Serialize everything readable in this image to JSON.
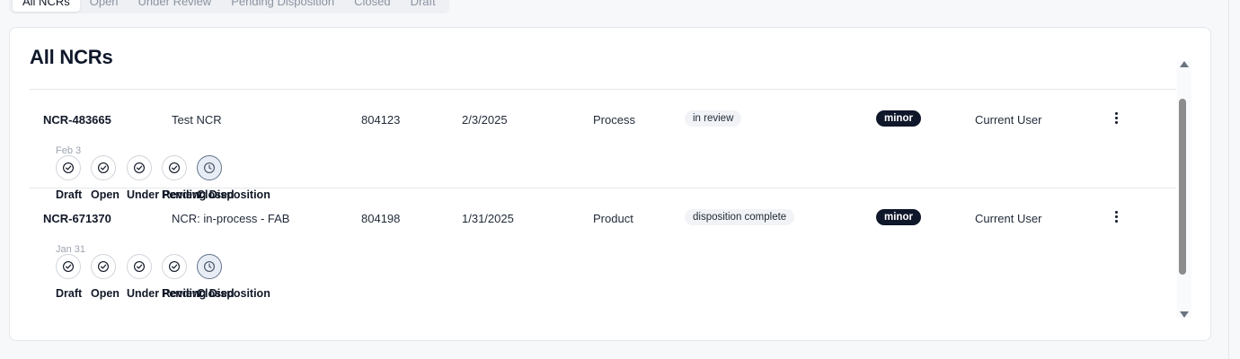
{
  "tabs": [
    "All NCRs",
    "Open",
    "Under Review",
    "Pending Disposition",
    "Closed",
    "Draft"
  ],
  "card_title": "All NCRs",
  "rows": [
    {
      "id": "NCR-483665",
      "title": "Test NCR",
      "part": "804123",
      "date": "2/3/2025",
      "type": "Process",
      "status": "in review",
      "severity": "minor",
      "owner": "Current User",
      "steps": [
        "Draft",
        "Open",
        "Under Review",
        "Pending Disposition",
        "Closed"
      ],
      "step_states": [
        "done",
        "done",
        "done",
        "done",
        "current"
      ],
      "step_date": "Feb 3"
    },
    {
      "id": "NCR-671370",
      "title": "NCR: in-process - FAB",
      "part": "804198",
      "date": "1/31/2025",
      "type": "Product",
      "status": "disposition complete",
      "severity": "minor",
      "owner": "Current User",
      "steps": [
        "Draft",
        "Open",
        "Under Review",
        "Pending Disposition",
        "Closed"
      ],
      "step_states": [
        "done",
        "done",
        "done",
        "done",
        "current"
      ],
      "step_date": "Jan 31"
    }
  ],
  "icons": {
    "done": "check-circle-icon",
    "current": "clock-icon",
    "menu": "more-vertical-icon"
  },
  "colors": {
    "severity_badge_bg": "#0f172a",
    "status_badge_bg": "#f1f3f6",
    "current_step_bg": "#e8ecf4"
  }
}
